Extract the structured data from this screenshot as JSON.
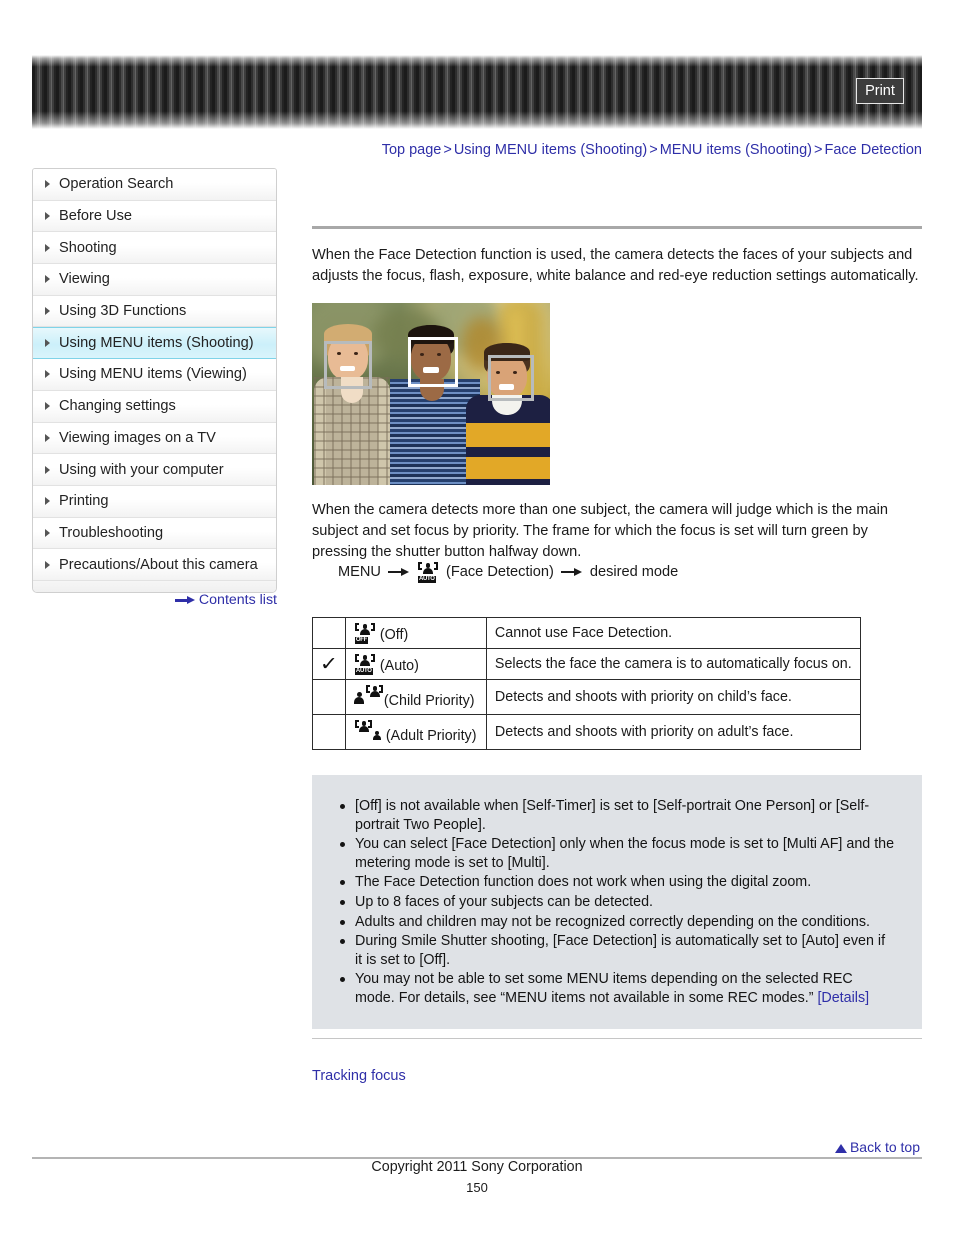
{
  "header": {
    "print_label": "Print"
  },
  "breadcrumb": {
    "items": [
      "Top page",
      "Using MENU items (Shooting)",
      "MENU items (Shooting)",
      "Face Detection"
    ],
    "separator": ">"
  },
  "sidebar": {
    "items": [
      {
        "label": "Operation Search",
        "active": false
      },
      {
        "label": "Before Use",
        "active": false
      },
      {
        "label": "Shooting",
        "active": false
      },
      {
        "label": "Viewing",
        "active": false
      },
      {
        "label": "Using 3D Functions",
        "active": false
      },
      {
        "label": "Using MENU items (Shooting)",
        "active": true
      },
      {
        "label": "Using MENU items (Viewing)",
        "active": false
      },
      {
        "label": "Changing settings",
        "active": false
      },
      {
        "label": "Viewing images on a TV",
        "active": false
      },
      {
        "label": "Using with your computer",
        "active": false
      },
      {
        "label": "Printing",
        "active": false
      },
      {
        "label": "Troubleshooting",
        "active": false
      },
      {
        "label": "Precautions/About this camera",
        "active": false
      }
    ],
    "contents_list_label": "Contents list"
  },
  "main": {
    "intro_paragraph": "When the Face Detection function is used, the camera detects the faces of your subjects and adjusts the focus, flash, exposure, white balance and red-eye reduction settings automatically.",
    "second_paragraph": "When the camera detects more than one subject, the camera will judge which is the main subject and set focus by priority. The frame for which the focus is set will turn green by pressing the shutter button halfway down.",
    "menu_path": {
      "menu_label": "MENU",
      "icon_label": "AUTO",
      "item_label": "(Face Detection)",
      "target_label": "desired mode"
    },
    "table": {
      "rows": [
        {
          "checked": "",
          "icon_tag": "OFF",
          "icon_type": "face-bracket",
          "mode": "(Off)",
          "description": "Cannot use Face Detection."
        },
        {
          "checked": "✓",
          "icon_tag": "AUTO",
          "icon_type": "face-bracket",
          "mode": "(Auto)",
          "description": "Selects the face the camera is to automatically focus on."
        },
        {
          "checked": "",
          "icon_tag": "",
          "icon_type": "adult-child",
          "mode": "(Child Priority)",
          "description": "Detects and shoots with priority on child’s face."
        },
        {
          "checked": "",
          "icon_tag": "",
          "icon_type": "child-adult",
          "mode": "(Adult Priority)",
          "description": "Detects and shoots with priority on adult’s face."
        }
      ]
    },
    "notes": [
      {
        "text": "[Off] is not available when [Self-Timer] is set to [Self-portrait One Person] or [Self-portrait Two People]."
      },
      {
        "text": "You can select [Face Detection] only when the focus mode is set to [Multi AF] and the metering mode is set to [Multi]."
      },
      {
        "text": "The Face Detection function does not work when using the digital zoom."
      },
      {
        "text": "Up to 8 faces of your subjects can be detected."
      },
      {
        "text": "Adults and children may not be recognized correctly depending on the conditions."
      },
      {
        "text": "During Smile Shutter shooting, [Face Detection] is automatically set to [Auto] even if it is set to [Off]."
      },
      {
        "text": "You may not be able to set some MENU items depending on the selected REC mode. For details, see “MENU items not available in some REC modes.” ",
        "link": "[Details]"
      }
    ],
    "tracking_focus_label": "Tracking focus",
    "photo_alt": "three children with face detection frames"
  },
  "footer": {
    "back_to_top_label": "Back to top",
    "copyright": "Copyright 2011 Sony Corporation",
    "page_number": "150"
  },
  "colors": {
    "link": "#2f2fa8",
    "active_nav": "#ccf0fa",
    "notes_bg": "#dfe2e6"
  }
}
